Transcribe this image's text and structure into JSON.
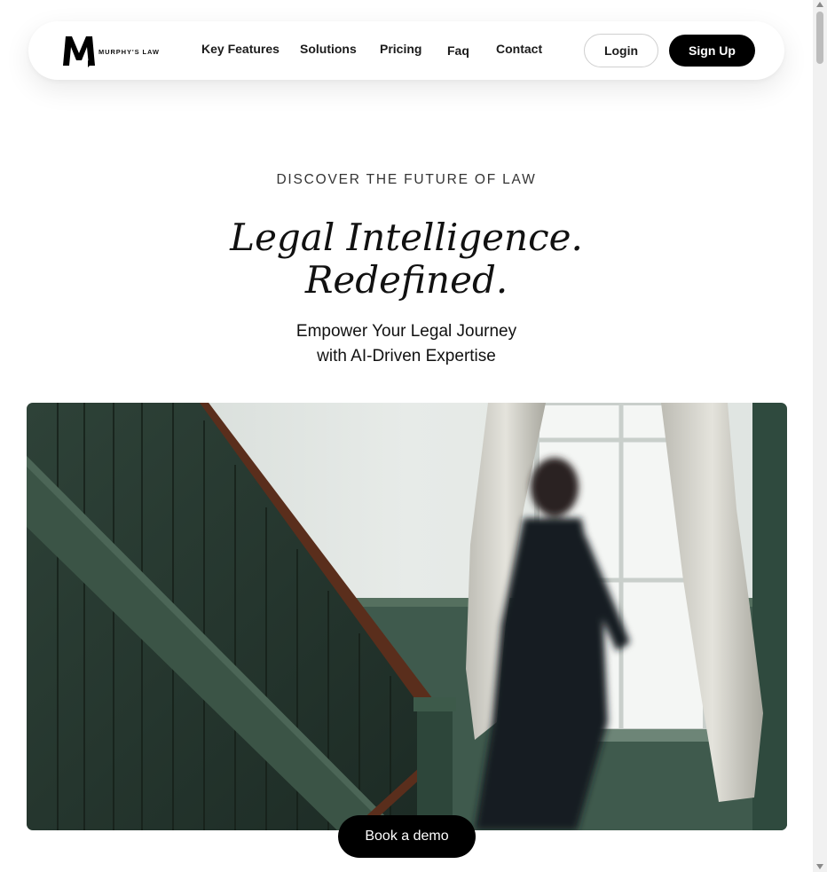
{
  "brand": {
    "logo_letter": "M",
    "logo_text": "MURPHY'S LAW"
  },
  "nav": {
    "links": [
      "Key Features",
      "Solutions",
      "Pricing",
      "Faq",
      "Contact"
    ],
    "login_label": "Login",
    "signup_label": "Sign Up"
  },
  "hero": {
    "eyebrow": "DISCOVER THE FUTURE OF LAW",
    "headline_line1": "Legal Intelligence.",
    "headline_line2": "Redefined.",
    "subhead_line1": "Empower Your Legal Journey",
    "subhead_line2": "with AI-Driven Expertise",
    "cta_label": "Book a demo"
  },
  "colors": {
    "primary": "#000000",
    "panel_green": "#2c3b33",
    "background": "#ffffff"
  }
}
